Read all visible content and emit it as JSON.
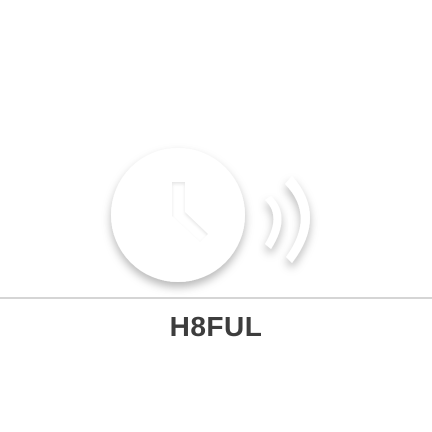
{
  "app": {
    "name": "H8FUL"
  },
  "logo": {
    "icon_clock": "clock-icon",
    "icon_waves": "sound-waves-icon"
  },
  "colors": {
    "background": "#ffffff",
    "divider": "#d5d5d5",
    "text": "#3d3d3d",
    "logo_fill": "#ffffff"
  }
}
